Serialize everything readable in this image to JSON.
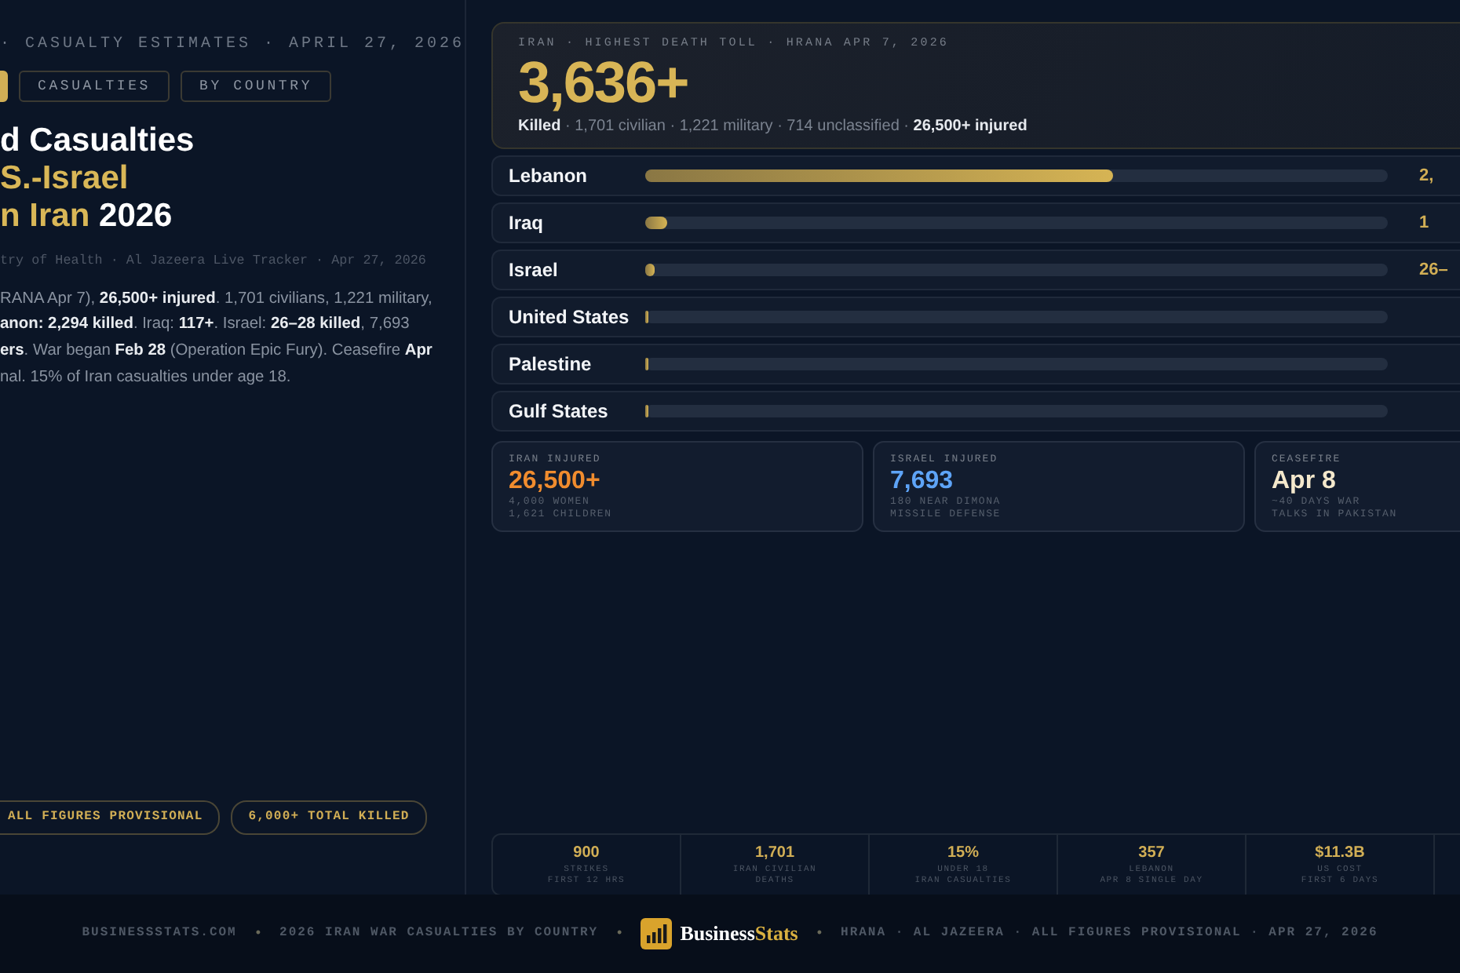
{
  "left": {
    "kicker": "· CASUALTY ESTIMATES · APRIL 27, 2026",
    "tabs": [
      {
        "selected": true
      },
      {
        "label": "CASUALTIES",
        "selected": false
      },
      {
        "label": "BY COUNTRY",
        "selected": false
      }
    ],
    "title_lines": [
      [
        {
          "text": "d Casualties",
          "accent": false
        }
      ],
      [
        {
          "text": "S.-Israel",
          "accent": true
        }
      ],
      [
        {
          "text": "n Iran",
          "accent": true
        },
        {
          "text": " 2026",
          "accent": false
        }
      ]
    ],
    "source": "try of Health · Al Jazeera Live Tracker · Apr 27, 2026",
    "summary_lines": [
      "RANA Apr 7), **26,500+ injured**. 1,701 civilians, 1,221 military,",
      "**anon: 2,294 killed**. Iraq: **117+**. Israel: **26–28 killed**, 7,693",
      "**ers**. War began **Feb 28** (Operation Epic Fury). Ceasefire **Apr**",
      "nal. 15% of Iran casualties under age 18."
    ],
    "pills": [
      "ALL FIGURES PROVISIONAL",
      "6,000+ TOTAL KILLED"
    ]
  },
  "hero": {
    "label": "IRAN · HIGHEST DEATH TOLL · HRANA APR 7, 2026",
    "value": "3,636+",
    "detail": "**Killed** · 1,701 civilian · 1,221 military · 714 unclassified · **26,500+ injured**"
  },
  "countries": [
    {
      "name": "Lebanon",
      "level": 0.63,
      "value": "2,"
    },
    {
      "name": "Iraq",
      "level": 0.03,
      "value": "1"
    },
    {
      "name": "Israel",
      "level": 0.012,
      "value": "26–"
    },
    {
      "name": "United States",
      "level": 0.005
    },
    {
      "name": "Palestine",
      "level": 0.005
    },
    {
      "name": "Gulf States",
      "level": 0.004
    }
  ],
  "cards": [
    {
      "label": "IRAN INJURED",
      "value": "26,500+",
      "color": "#f08c2e",
      "notes": [
        "4,000 WOMEN",
        "1,621 CHILDREN"
      ]
    },
    {
      "label": "ISRAEL INJURED",
      "value": "7,693",
      "color": "#5ea4f7",
      "notes": [
        "180 NEAR DIMONA",
        "MISSILE DEFENSE"
      ]
    },
    {
      "label": "CEASEFIRE",
      "value": "Apr 8",
      "color": "#f4e8cc",
      "notes": [
        "~40 DAYS WAR",
        "TALKS IN PAKISTAN"
      ]
    }
  ],
  "stats": [
    {
      "value": "900",
      "notes": [
        "STRIKES",
        "FIRST 12 HRS"
      ]
    },
    {
      "value": "1,701",
      "notes": [
        "IRAN CIVILIAN",
        "DEATHS"
      ]
    },
    {
      "value": "15%",
      "notes": [
        "UNDER 18",
        "IRAN CASUALTIES"
      ]
    },
    {
      "value": "357",
      "notes": [
        "LEBANON",
        "APR 8 SINGLE DAY"
      ]
    },
    {
      "value": "$11.3B",
      "notes": [
        "US COST",
        "FIRST 6 DAYS"
      ]
    }
  ],
  "footer": [
    {
      "kind": "text",
      "text": "BUSINESSSTATS.COM"
    },
    {
      "kind": "sep",
      "text": "•"
    },
    {
      "kind": "text",
      "text": "2026 IRAN WAR CASUALTIES BY COUNTRY"
    },
    {
      "kind": "sep",
      "text": "•"
    },
    {
      "kind": "logo",
      "text": "Business",
      "accent_text": "Stats"
    },
    {
      "kind": "sep",
      "text": "•"
    },
    {
      "kind": "text",
      "text": "HRANA · AL JAZEERA · ALL FIGURES PROVISIONAL · APR 27, 2026"
    }
  ]
}
